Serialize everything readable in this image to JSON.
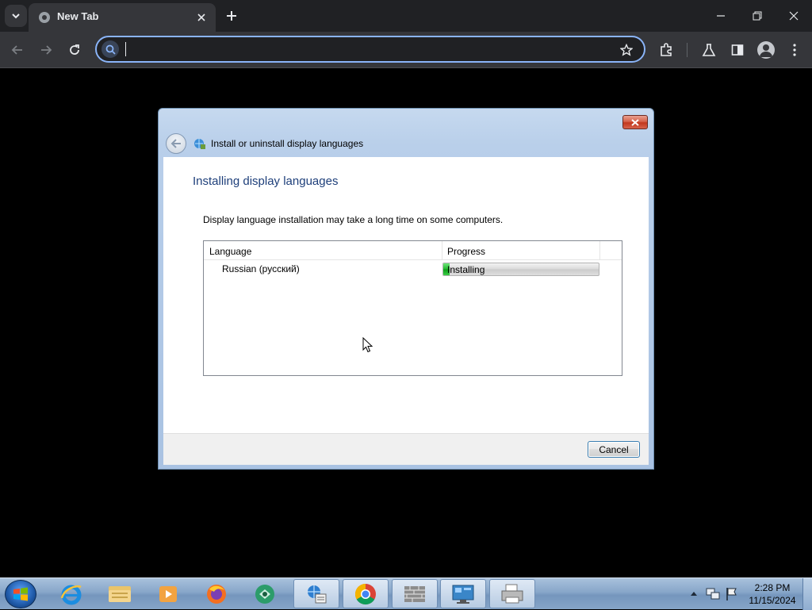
{
  "browser": {
    "tab": {
      "title": "New Tab"
    },
    "omnibox": {
      "value": "",
      "placeholder": ""
    }
  },
  "dialog": {
    "nav_title": "Install or uninstall display languages",
    "heading": "Installing display languages",
    "description": "Display language installation may take a long time on some computers.",
    "columns": {
      "language": "Language",
      "progress": "Progress"
    },
    "rows": [
      {
        "language": "Russian (русский)",
        "status": "Installing",
        "progress_fraction": 0.04
      }
    ],
    "cancel_label": "Cancel"
  },
  "taskbar": {
    "items": [
      "internet-explorer-icon",
      "windows-explorer-icon",
      "media-player-icon",
      "firefox-icon",
      "green-app-icon",
      "network-settings-icon",
      "chrome-icon",
      "firewall-icon",
      "control-panel-icon",
      "printer-icon"
    ],
    "clock": {
      "time": "2:28 PM",
      "date": "11/15/2024"
    }
  },
  "colors": {
    "accent": "#8ab4f8",
    "dialog_heading": "#1e3f7a",
    "progress_green": "#1fb52c"
  }
}
